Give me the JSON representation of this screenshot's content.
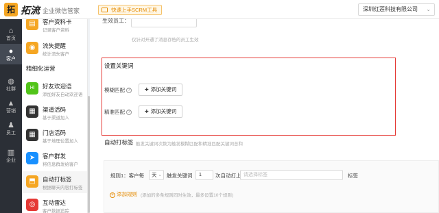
{
  "header": {
    "logo_badge": "拓",
    "logo_text": "拓流",
    "subtitle": "企业微信管家",
    "quick_button": "快速上手SCRM工具",
    "company": "深圳红莲科技有限公司"
  },
  "rail": {
    "items": [
      {
        "label": "首页",
        "icon": "home-icon",
        "glyph": "⌂"
      },
      {
        "label": "客户",
        "icon": "user-icon",
        "glyph": "●"
      },
      {
        "label": "社群",
        "icon": "chat-icon",
        "glyph": "◍"
      },
      {
        "label": "营销",
        "icon": "thumb-icon",
        "glyph": "▲"
      },
      {
        "label": "员工",
        "icon": "staff-icon",
        "glyph": "♟"
      },
      {
        "label": "企业",
        "icon": "building-icon",
        "glyph": "▥"
      }
    ]
  },
  "submenu": {
    "group_label": "精细化运营",
    "items": [
      {
        "title": "客户资料卡",
        "desc": "记录客户资料",
        "icon": "profile-icon",
        "color": "#f5a623",
        "glyph": "▤"
      },
      {
        "title": "流失提醒",
        "desc": "统计流失客户",
        "icon": "alert-icon",
        "color": "#f5a623",
        "glyph": "◉"
      },
      {
        "title": "好友欢迎语",
        "desc": "添加好友自动欢迎语",
        "icon": "welcome-icon",
        "color": "#52c41a",
        "glyph": "Hi"
      },
      {
        "title": "渠道活码",
        "desc": "基于渠道加人",
        "icon": "qrcode-icon",
        "color": "#333333",
        "glyph": "▦"
      },
      {
        "title": "门店活码",
        "desc": "基于地理位置加人",
        "icon": "store-qrcode-icon",
        "color": "#333333",
        "glyph": "▦"
      },
      {
        "title": "客户群发",
        "desc": "将信息群发给客户",
        "icon": "send-icon",
        "color": "#1890ff",
        "glyph": "➤"
      },
      {
        "title": "自动打标签",
        "desc": "根据聊天内容打标签",
        "icon": "tag-icon",
        "color": "#f5a623",
        "glyph": "⬒"
      },
      {
        "title": "互动雷达",
        "desc": "客户数据追踪",
        "icon": "radar-icon",
        "color": "#e53935",
        "glyph": "◎"
      }
    ]
  },
  "main": {
    "partial_label": "生效员工：",
    "partial_input": "",
    "hint": "仅针对开通了消息存档的员工生效",
    "keyword_section": {
      "heading": "设置关键词",
      "fuzzy_label": "模糊匹配",
      "exact_label": "精准匹配",
      "help_glyph": "?",
      "add_keyword": "添加关键词"
    },
    "auto_tag": {
      "label": "自动打标签",
      "desc": "触发关键词次数为触发模糊匹配和精准匹配关键词总和"
    },
    "rule": {
      "prefix": "规则1：客户每",
      "period": "天",
      "trigger": "触发关键词",
      "count": "1",
      "suffix": "次自动打上",
      "tag_placeholder": "请选择标签",
      "tag_word": "标签",
      "add_rule": "添加规则",
      "add_rule_hint": "(添加的多条规则同时生效，最多设置10个规则)"
    }
  }
}
